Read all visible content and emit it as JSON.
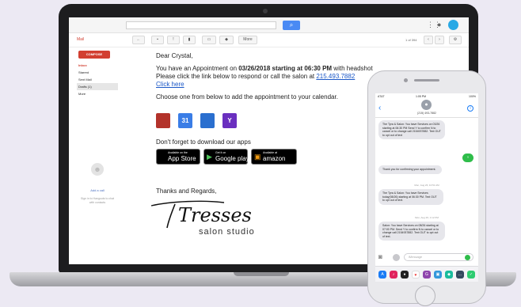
{
  "gmail": {
    "mail_label": "Mail",
    "compose_label": "COMPOSE",
    "nav": [
      "Inbox",
      "Starred",
      "Sent Mail",
      "Drafts (1)",
      "More"
    ],
    "toolbar_more": "More",
    "paging": "1 of 394",
    "hangout_title": "Add a call",
    "hangout_sub": "Sign in to Hangouts to chat with contacts"
  },
  "email": {
    "greeting": "Dear Crystal,",
    "appt_prefix": "You have an Appointment on ",
    "appt_bold": "03/26/2018 starting at 06:30 PM",
    "appt_suffix": " with headshot",
    "respond_prefix": "Please click the link below to respond or call the salon at ",
    "phone_link": "215.493.7882",
    "click_here": "Click here",
    "choose_text": "Choose one from below to add the appointment to your calendar.",
    "download_text": "Don't forget to download our apps",
    "thanks": "Thanks and Regards,",
    "logo_script": "Tresses",
    "logo_sub": "salon studio"
  },
  "stores": {
    "appstore_small": "Available on the",
    "appstore_big": "App Store",
    "google_small": "Get it on",
    "google_big": "Google play",
    "amazon_small": "Available at",
    "amazon_big": "amazon"
  },
  "calendar_icons": [
    {
      "name": "calendar-red-icon",
      "glyph": "",
      "color": "#b3332b"
    },
    {
      "name": "google-calendar-icon",
      "glyph": "31",
      "color": "#3a7de6"
    },
    {
      "name": "outlook-calendar-icon",
      "glyph": "",
      "color": "#2a6fcf"
    },
    {
      "name": "yahoo-calendar-icon",
      "glyph": "Y",
      "color": "#6a2fbf"
    }
  ],
  "phone": {
    "status_carrier": "AT&T",
    "status_time": "1:05 PM",
    "status_battery": "100%",
    "contact_number": "(215) 493-7882",
    "ts1": "Mon, Aug 26, 10:51 AM",
    "ts2": "Mon, Aug 26, 1:12 PM",
    "input_placeholder": "iMessage",
    "messages": [
      {
        "side": "in",
        "text": "The Tyra & Salon: You have Services on 03/26 starting at 06:30 PM Send Y to confirm N to cancel or to change call 2154937882. Text OUT to opt out of text"
      },
      {
        "side": "out",
        "text": "Y"
      },
      {
        "side": "in",
        "text": "Thank you for confirming your appointment."
      },
      {
        "side": "in",
        "text": "The Tyra & Salon: You have Services today(08/26) starting at 06:30 PM. Text OUT to opt out of text."
      },
      {
        "side": "in",
        "text": "Salon: You have Services on 08/26 starting at 07:00 PM. Send Y to confirm N to cancel or to change call 2154937882. Text OUT to opt out of text."
      }
    ]
  },
  "colors": {
    "gmail_red": "#d23f31",
    "link_blue": "#1a57c7",
    "imessage_green": "#2fbd4a",
    "ios_blue": "#1a7cf5"
  }
}
